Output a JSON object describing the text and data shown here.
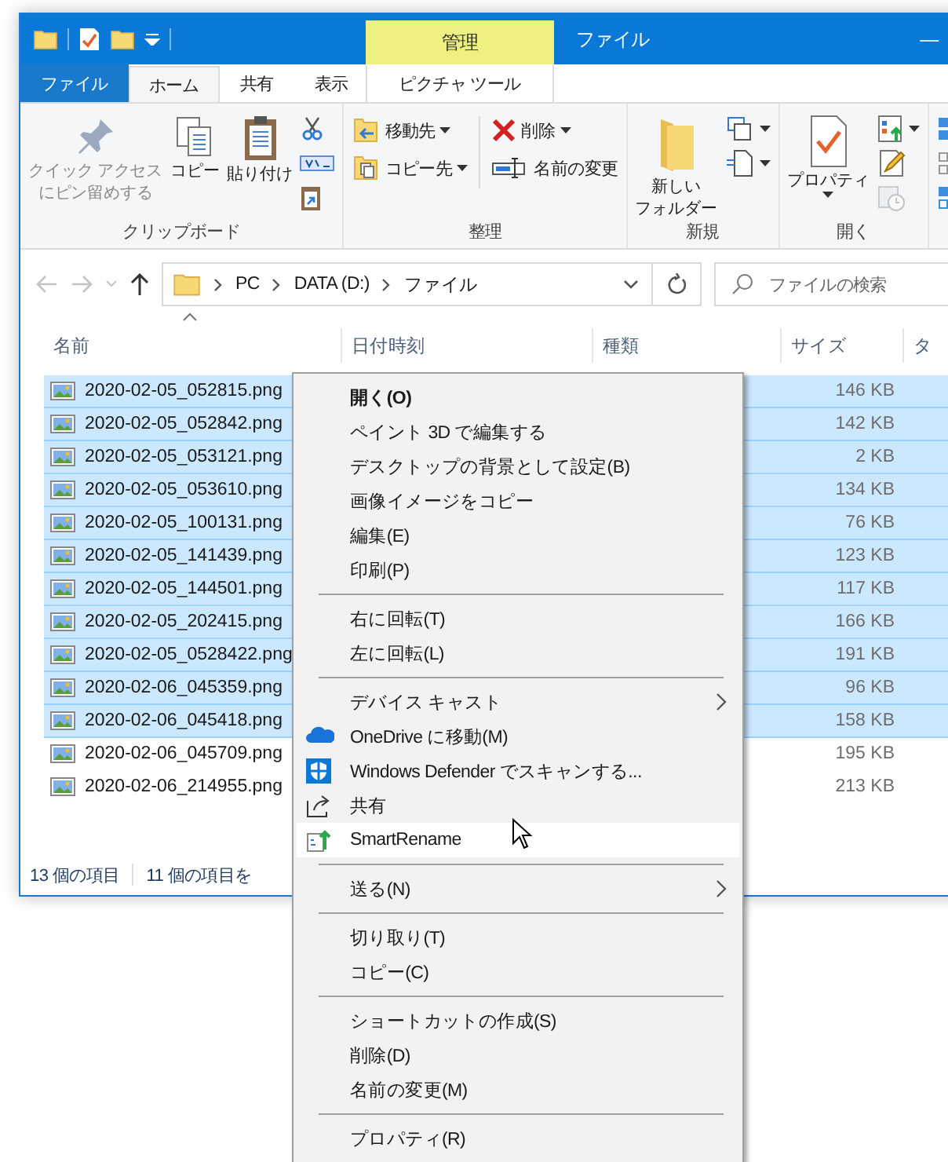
{
  "title_bar": {
    "context_tab": "管理",
    "title": "ファイル",
    "minimize": "—"
  },
  "ribbon_tabs": [
    {
      "label": "ファイル",
      "kind": "file",
      "selected": false
    },
    {
      "label": "ホーム",
      "kind": "tab",
      "selected": true
    },
    {
      "label": "共有",
      "kind": "tab",
      "selected": false
    },
    {
      "label": "表示",
      "kind": "tab",
      "selected": false
    },
    {
      "label": "ピクチャ ツール",
      "kind": "context",
      "selected": false
    }
  ],
  "ribbon_groups": [
    {
      "label": "クリップボード",
      "buttons": [
        {
          "kind": "large",
          "lines": [
            "クイック アクセス",
            "にピン留めする"
          ],
          "disabled": true,
          "dropdown": false
        },
        {
          "kind": "large",
          "lines": [
            "コピー"
          ],
          "disabled": false,
          "dropdown": false
        },
        {
          "kind": "large",
          "lines": [
            "貼り付け"
          ],
          "disabled": false,
          "dropdown": false
        },
        {
          "kind": "icon",
          "disabled": false,
          "dropdown": false
        },
        {
          "kind": "icon",
          "disabled": false,
          "dropdown": false
        },
        {
          "kind": "icon",
          "disabled": false,
          "dropdown": false
        }
      ]
    },
    {
      "label": "整理",
      "buttons": [
        {
          "kind": "small",
          "label": "移動先",
          "disabled": false,
          "dropdown": true
        },
        {
          "kind": "small",
          "label": "コピー先",
          "disabled": false,
          "dropdown": true
        },
        {
          "kind": "small",
          "label": "削除",
          "disabled": false,
          "dropdown": true
        },
        {
          "kind": "small",
          "label": "名前の変更",
          "disabled": false,
          "dropdown": false
        }
      ]
    },
    {
      "label": "新規",
      "buttons": [
        {
          "kind": "large",
          "lines": [
            "新しい",
            "フォルダー"
          ],
          "disabled": false,
          "dropdown": false
        },
        {
          "kind": "icon",
          "disabled": false,
          "dropdown": true
        },
        {
          "kind": "icon",
          "disabled": false,
          "dropdown": true
        }
      ]
    },
    {
      "label": "開く",
      "buttons": [
        {
          "kind": "large",
          "lines": [
            "プロパティ"
          ],
          "disabled": false,
          "dropdown": true
        },
        {
          "kind": "icon",
          "disabled": false,
          "dropdown": true
        },
        {
          "kind": "icon",
          "disabled": false,
          "dropdown": false
        },
        {
          "kind": "icon",
          "disabled": true,
          "dropdown": false
        }
      ]
    },
    {
      "buttons": [
        {
          "kind": "icon"
        },
        {
          "kind": "icon"
        },
        {
          "kind": "icon"
        }
      ]
    }
  ],
  "address": {
    "path": [
      "PC",
      "DATA (D:)",
      "ファイル"
    ],
    "search_placeholder": "ファイルの検索"
  },
  "columns": [
    "名前",
    "日付時刻",
    "種類",
    "サイズ",
    "タ"
  ],
  "rows": [
    {
      "name": "2020-02-05_052815.png",
      "size": "146 KB",
      "selected": true
    },
    {
      "name": "2020-02-05_052842.png",
      "size": "142 KB",
      "selected": true
    },
    {
      "name": "2020-02-05_053121.png",
      "size": "2 KB",
      "selected": true
    },
    {
      "name": "2020-02-05_053610.png",
      "size": "134 KB",
      "selected": true
    },
    {
      "name": "2020-02-05_100131.png",
      "size": "76 KB",
      "selected": true
    },
    {
      "name": "2020-02-05_141439.png",
      "size": "123 KB",
      "selected": true
    },
    {
      "name": "2020-02-05_144501.png",
      "size": "117 KB",
      "selected": true
    },
    {
      "name": "2020-02-05_202415.png",
      "size": "166 KB",
      "selected": true
    },
    {
      "name": "2020-02-05_0528422.png",
      "size": "191 KB",
      "selected": true
    },
    {
      "name": "2020-02-06_045359.png",
      "size": "96 KB",
      "selected": true
    },
    {
      "name": "2020-02-06_045418.png",
      "size": "158 KB",
      "selected": true
    },
    {
      "name": "2020-02-06_045709.png",
      "size": "195 KB",
      "selected": false
    },
    {
      "name": "2020-02-06_214955.png",
      "size": "213 KB",
      "selected": false
    }
  ],
  "status_bar": [
    "13 個の項目",
    "11 個の項目を"
  ],
  "context_menu": [
    {
      "kind": "item",
      "label": "開く(O)",
      "bold": true,
      "submenu": false,
      "highlighted": false
    },
    {
      "kind": "item",
      "label": "ペイント 3D で編集する",
      "bold": false,
      "submenu": false,
      "highlighted": false
    },
    {
      "kind": "item",
      "label": "デスクトップの背景として設定(B)",
      "bold": false,
      "submenu": false,
      "highlighted": false
    },
    {
      "kind": "item",
      "label": "画像イメージをコピー",
      "bold": false,
      "submenu": false,
      "highlighted": false
    },
    {
      "kind": "item",
      "label": "編集(E)",
      "bold": false,
      "submenu": false,
      "highlighted": false
    },
    {
      "kind": "item",
      "label": "印刷(P)",
      "bold": false,
      "submenu": false,
      "highlighted": false
    },
    {
      "kind": "separator"
    },
    {
      "kind": "item",
      "label": "右に回転(T)",
      "bold": false,
      "submenu": false,
      "highlighted": false
    },
    {
      "kind": "item",
      "label": "左に回転(L)",
      "bold": false,
      "submenu": false,
      "highlighted": false
    },
    {
      "kind": "separator"
    },
    {
      "kind": "item",
      "label": "デバイス キャスト",
      "bold": false,
      "submenu": true,
      "highlighted": false
    },
    {
      "kind": "item",
      "label": "OneDrive に移動(M)",
      "bold": false,
      "submenu": false,
      "highlighted": false
    },
    {
      "kind": "item",
      "label": "Windows Defender でスキャンする...",
      "bold": false,
      "submenu": false,
      "highlighted": false
    },
    {
      "kind": "item",
      "label": "共有",
      "bold": false,
      "submenu": false,
      "highlighted": false
    },
    {
      "kind": "item",
      "label": "SmartRename",
      "bold": false,
      "submenu": false,
      "highlighted": true
    },
    {
      "kind": "separator"
    },
    {
      "kind": "item",
      "label": "送る(N)",
      "bold": false,
      "submenu": true,
      "highlighted": false
    },
    {
      "kind": "separator"
    },
    {
      "kind": "item",
      "label": "切り取り(T)",
      "bold": false,
      "submenu": false,
      "highlighted": false
    },
    {
      "kind": "item",
      "label": "コピー(C)",
      "bold": false,
      "submenu": false,
      "highlighted": false
    },
    {
      "kind": "separator"
    },
    {
      "kind": "item",
      "label": "ショートカットの作成(S)",
      "bold": false,
      "submenu": false,
      "highlighted": false
    },
    {
      "kind": "item",
      "label": "削除(D)",
      "bold": false,
      "submenu": false,
      "highlighted": false
    },
    {
      "kind": "item",
      "label": "名前の変更(M)",
      "bold": false,
      "submenu": false,
      "highlighted": false
    },
    {
      "kind": "separator"
    },
    {
      "kind": "item",
      "label": "プロパティ(R)",
      "bold": false,
      "submenu": false,
      "highlighted": false
    }
  ]
}
